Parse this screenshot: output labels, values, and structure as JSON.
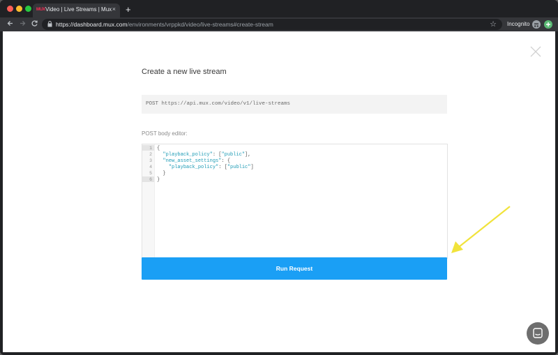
{
  "browser": {
    "tab_favicon_text": "MUX",
    "tab_title": "Video | Live Streams | Mux",
    "tab_close": "×",
    "new_tab": "+",
    "url_host": "https://dashboard.mux.com",
    "url_path": "/environments/vrppkd/video/live-streams#create-stream",
    "incognito_label": "Incognito"
  },
  "page": {
    "title": "Create a new live stream",
    "endpoint": "POST https://api.mux.com/video/v1/live-streams",
    "body_label": "POST body editor:",
    "run_button": "Run Request"
  },
  "editor": {
    "line_numbers": [
      "1",
      "2",
      "3",
      "4",
      "5",
      "6"
    ],
    "line1": "{",
    "line2_key": "\"playback_policy\"",
    "line2_rest_open": ": [",
    "line2_value": "\"public\"",
    "line2_rest_close": "],",
    "line3_key": "\"new_asset_settings\"",
    "line3_rest": ": {",
    "line4_key": "\"playback_policy\"",
    "line4_rest_open": ": [",
    "line4_value": "\"public\"",
    "line4_rest_close": "]",
    "line5": "}",
    "line6": "}"
  },
  "icons": {
    "back": "back-arrow-icon",
    "forward": "forward-arrow-icon",
    "reload": "reload-icon",
    "lock": "lock-icon",
    "star": "bookmark-star-icon",
    "close": "close-icon",
    "chat": "chat-icon",
    "annotation": "yellow-arrow-icon"
  },
  "colors": {
    "accent": "#1a9ff5",
    "annotation_arrow": "#f1e33b",
    "code_key": "#1d9bb5"
  }
}
